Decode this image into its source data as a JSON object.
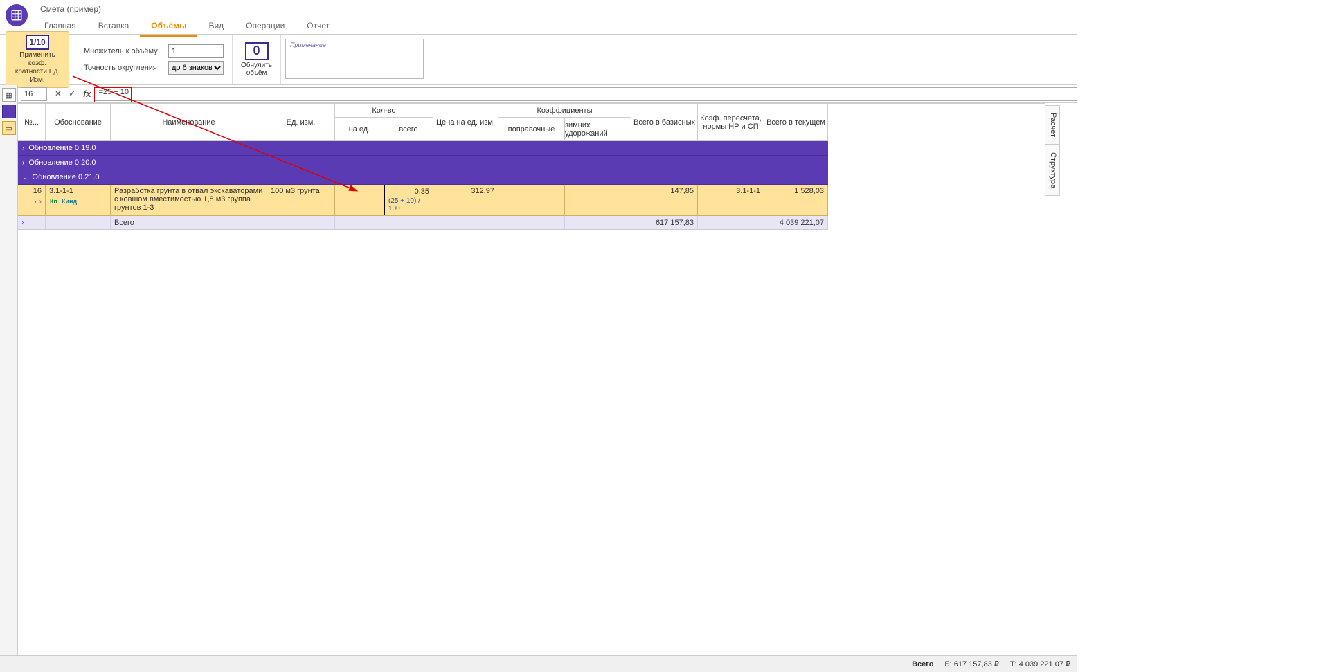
{
  "title": "Смета (пример)",
  "tabs": [
    "Главная",
    "Вставка",
    "Объёмы",
    "Вид",
    "Операции",
    "Отчет"
  ],
  "active_tab_index": 2,
  "ribbon": {
    "apply_coef": {
      "icon": "1/10",
      "line1": "Применить коэф.",
      "line2": "кратности Ед. Изм."
    },
    "multiplier_label": "Множитель к объёму",
    "multiplier_value": "1",
    "precision_label": "Точность округления",
    "precision_value": "до 6 знаков",
    "zero_label1": "Обнулить",
    "zero_label2": "объём",
    "note_placeholder": "Примечание"
  },
  "formula_bar": {
    "cell_ref": "16",
    "formula": "=25 + 10"
  },
  "columns": {
    "num": "№...",
    "obos": "Обоснование",
    "name": "Наименование",
    "unit": "Ед. изм.",
    "qty": "Кол-во",
    "qty_per_unit": "на ед.",
    "qty_total": "всего",
    "price": "Цена на ед. изм.",
    "coef": "Коэффициенты",
    "coef_corr": "поправочные",
    "coef_winter": "зимних удорожаний",
    "base_total": "Всего в базисных",
    "recalc": "Коэф. пересчета, нормы НР и СП",
    "curr_total": "Всего в текущем"
  },
  "sections": [
    {
      "label": "Обновление 0.19.0",
      "expanded": false
    },
    {
      "label": "Обновление 0.20.0",
      "expanded": false
    },
    {
      "label": "Обновление 0.21.0",
      "expanded": true
    }
  ],
  "row": {
    "num": "16",
    "code": "3.1-1-1",
    "k_badges": [
      "Кп",
      "Кинд"
    ],
    "name": "Разработка грунта в отвал экскаваторами с ковшом вместимостью 1,8 м3 группа грунтов 1-3",
    "unit": "100 м3 грунта",
    "qty_total": "0,35",
    "qty_formula": "(25 + 10) / 100",
    "price": "312,97",
    "base_total": "147,85",
    "recalc": "3.1-1-1",
    "curr_total": "1 528,03"
  },
  "summary": {
    "label": "Всего",
    "base": "617 157,83",
    "curr": "4 039 221,07"
  },
  "right_tabs": [
    "Расчет",
    "Структура"
  ],
  "doc_tab": "Смета (пример)",
  "status": {
    "total_label": "Всего",
    "base": "Б: 617 157,83 ₽",
    "curr": "Т: 4 039 221,07 ₽"
  }
}
